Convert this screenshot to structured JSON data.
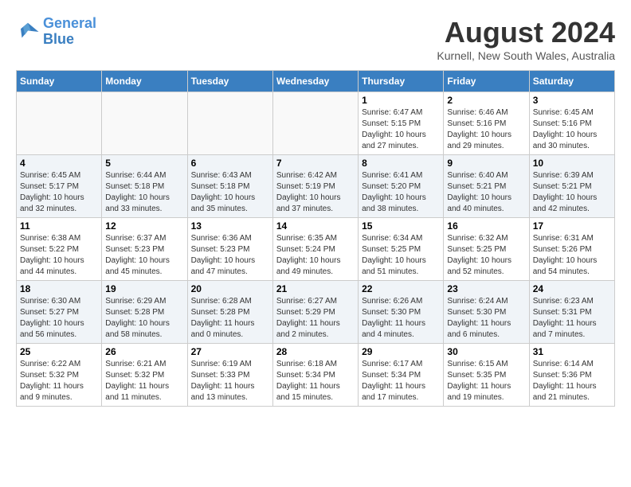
{
  "header": {
    "logo": {
      "line1": "General",
      "line2": "Blue"
    },
    "title": "August 2024",
    "location": "Kurnell, New South Wales, Australia"
  },
  "days_of_week": [
    "Sunday",
    "Monday",
    "Tuesday",
    "Wednesday",
    "Thursday",
    "Friday",
    "Saturday"
  ],
  "weeks": [
    [
      {
        "day": "",
        "info": ""
      },
      {
        "day": "",
        "info": ""
      },
      {
        "day": "",
        "info": ""
      },
      {
        "day": "",
        "info": ""
      },
      {
        "day": "1",
        "info": "Sunrise: 6:47 AM\nSunset: 5:15 PM\nDaylight: 10 hours\nand 27 minutes."
      },
      {
        "day": "2",
        "info": "Sunrise: 6:46 AM\nSunset: 5:16 PM\nDaylight: 10 hours\nand 29 minutes."
      },
      {
        "day": "3",
        "info": "Sunrise: 6:45 AM\nSunset: 5:16 PM\nDaylight: 10 hours\nand 30 minutes."
      }
    ],
    [
      {
        "day": "4",
        "info": "Sunrise: 6:45 AM\nSunset: 5:17 PM\nDaylight: 10 hours\nand 32 minutes."
      },
      {
        "day": "5",
        "info": "Sunrise: 6:44 AM\nSunset: 5:18 PM\nDaylight: 10 hours\nand 33 minutes."
      },
      {
        "day": "6",
        "info": "Sunrise: 6:43 AM\nSunset: 5:18 PM\nDaylight: 10 hours\nand 35 minutes."
      },
      {
        "day": "7",
        "info": "Sunrise: 6:42 AM\nSunset: 5:19 PM\nDaylight: 10 hours\nand 37 minutes."
      },
      {
        "day": "8",
        "info": "Sunrise: 6:41 AM\nSunset: 5:20 PM\nDaylight: 10 hours\nand 38 minutes."
      },
      {
        "day": "9",
        "info": "Sunrise: 6:40 AM\nSunset: 5:21 PM\nDaylight: 10 hours\nand 40 minutes."
      },
      {
        "day": "10",
        "info": "Sunrise: 6:39 AM\nSunset: 5:21 PM\nDaylight: 10 hours\nand 42 minutes."
      }
    ],
    [
      {
        "day": "11",
        "info": "Sunrise: 6:38 AM\nSunset: 5:22 PM\nDaylight: 10 hours\nand 44 minutes."
      },
      {
        "day": "12",
        "info": "Sunrise: 6:37 AM\nSunset: 5:23 PM\nDaylight: 10 hours\nand 45 minutes."
      },
      {
        "day": "13",
        "info": "Sunrise: 6:36 AM\nSunset: 5:23 PM\nDaylight: 10 hours\nand 47 minutes."
      },
      {
        "day": "14",
        "info": "Sunrise: 6:35 AM\nSunset: 5:24 PM\nDaylight: 10 hours\nand 49 minutes."
      },
      {
        "day": "15",
        "info": "Sunrise: 6:34 AM\nSunset: 5:25 PM\nDaylight: 10 hours\nand 51 minutes."
      },
      {
        "day": "16",
        "info": "Sunrise: 6:32 AM\nSunset: 5:25 PM\nDaylight: 10 hours\nand 52 minutes."
      },
      {
        "day": "17",
        "info": "Sunrise: 6:31 AM\nSunset: 5:26 PM\nDaylight: 10 hours\nand 54 minutes."
      }
    ],
    [
      {
        "day": "18",
        "info": "Sunrise: 6:30 AM\nSunset: 5:27 PM\nDaylight: 10 hours\nand 56 minutes."
      },
      {
        "day": "19",
        "info": "Sunrise: 6:29 AM\nSunset: 5:28 PM\nDaylight: 10 hours\nand 58 minutes."
      },
      {
        "day": "20",
        "info": "Sunrise: 6:28 AM\nSunset: 5:28 PM\nDaylight: 11 hours\nand 0 minutes."
      },
      {
        "day": "21",
        "info": "Sunrise: 6:27 AM\nSunset: 5:29 PM\nDaylight: 11 hours\nand 2 minutes."
      },
      {
        "day": "22",
        "info": "Sunrise: 6:26 AM\nSunset: 5:30 PM\nDaylight: 11 hours\nand 4 minutes."
      },
      {
        "day": "23",
        "info": "Sunrise: 6:24 AM\nSunset: 5:30 PM\nDaylight: 11 hours\nand 6 minutes."
      },
      {
        "day": "24",
        "info": "Sunrise: 6:23 AM\nSunset: 5:31 PM\nDaylight: 11 hours\nand 7 minutes."
      }
    ],
    [
      {
        "day": "25",
        "info": "Sunrise: 6:22 AM\nSunset: 5:32 PM\nDaylight: 11 hours\nand 9 minutes."
      },
      {
        "day": "26",
        "info": "Sunrise: 6:21 AM\nSunset: 5:32 PM\nDaylight: 11 hours\nand 11 minutes."
      },
      {
        "day": "27",
        "info": "Sunrise: 6:19 AM\nSunset: 5:33 PM\nDaylight: 11 hours\nand 13 minutes."
      },
      {
        "day": "28",
        "info": "Sunrise: 6:18 AM\nSunset: 5:34 PM\nDaylight: 11 hours\nand 15 minutes."
      },
      {
        "day": "29",
        "info": "Sunrise: 6:17 AM\nSunset: 5:34 PM\nDaylight: 11 hours\nand 17 minutes."
      },
      {
        "day": "30",
        "info": "Sunrise: 6:15 AM\nSunset: 5:35 PM\nDaylight: 11 hours\nand 19 minutes."
      },
      {
        "day": "31",
        "info": "Sunrise: 6:14 AM\nSunset: 5:36 PM\nDaylight: 11 hours\nand 21 minutes."
      }
    ]
  ]
}
